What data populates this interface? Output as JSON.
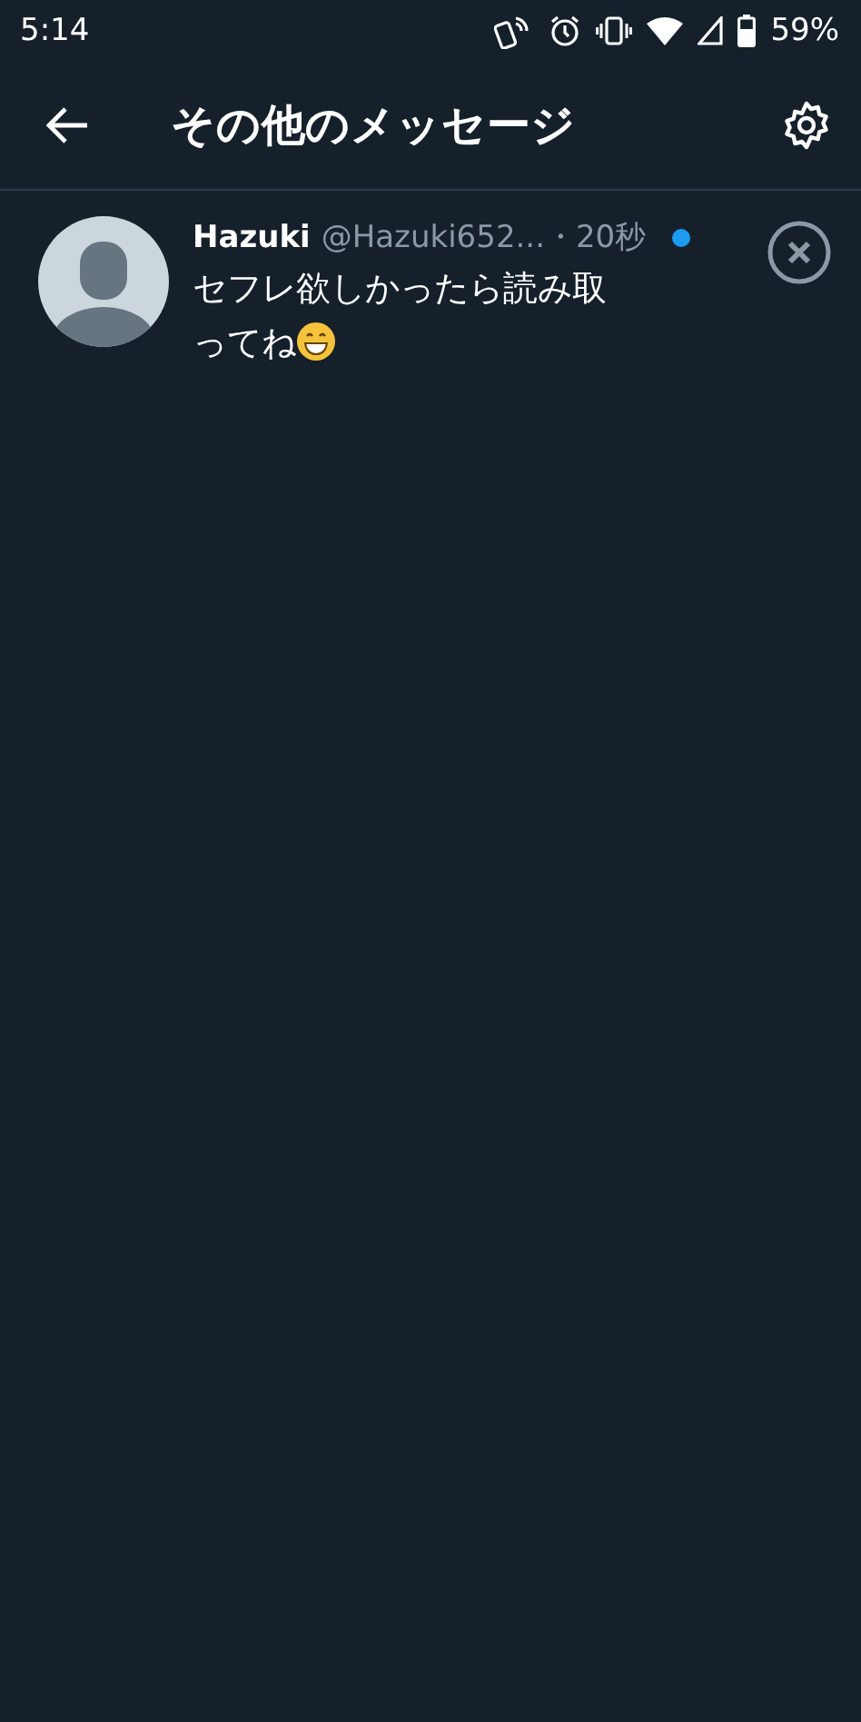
{
  "status_bar": {
    "time": "5:14",
    "battery": "59%"
  },
  "header": {
    "title": "その他のメッセージ"
  },
  "conversations": [
    {
      "name": "Hazuki",
      "handle": "@Hazuki652...",
      "time": "・20秒",
      "unread": true,
      "message_lines": [
        "セフレ欲しかったら読み取",
        "ってね"
      ]
    }
  ]
}
